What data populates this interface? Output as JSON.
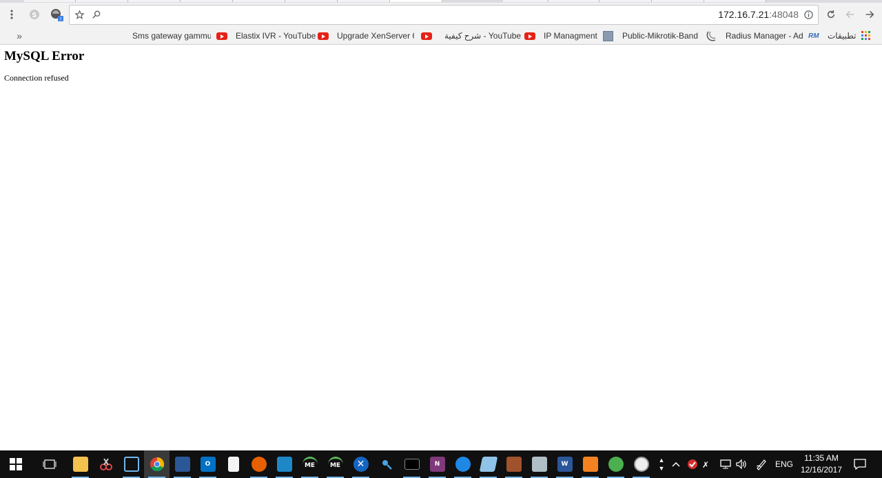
{
  "browser": {
    "url_host": "172.16.7.21",
    "url_port": ":48048",
    "url_value": "172.16.7.21:48048"
  },
  "bookmarks": {
    "overflow_label": "»",
    "items": [
      {
        "label": "Sms gateway gammu",
        "icon": "page-icon"
      },
      {
        "label": "Elastix IVR - YouTube",
        "icon": "youtube-icon"
      },
      {
        "label": "Upgrade XenServer 6",
        "icon": "youtube-icon"
      },
      {
        "label": "شرح كيفية - YouTube",
        "icon": "youtube-icon"
      },
      {
        "label": "IP Managment",
        "icon": "youtube-icon"
      },
      {
        "label": "Public-Mikrotik-Band",
        "icon": "phpipam-icon"
      },
      {
        "label": "Radius Manager - Ad",
        "icon": "radius-icon"
      },
      {
        "label": "تطبيقات",
        "icon": "apps-grid-icon"
      }
    ]
  },
  "page": {
    "heading": "MySQL Error",
    "message": "Connection refused"
  },
  "taskbar": {
    "language": "ENG",
    "time": "11:35 AM",
    "date": "12/16/2017",
    "me_label_1": "ME",
    "me_label_2": "ME",
    "outlook_label": "O",
    "word_label": "W",
    "onenote_label": "N"
  },
  "colors": {
    "youtube_red": "#e62117",
    "taskbar_bg": "#101010",
    "running_indicator": "#76b9ed"
  }
}
